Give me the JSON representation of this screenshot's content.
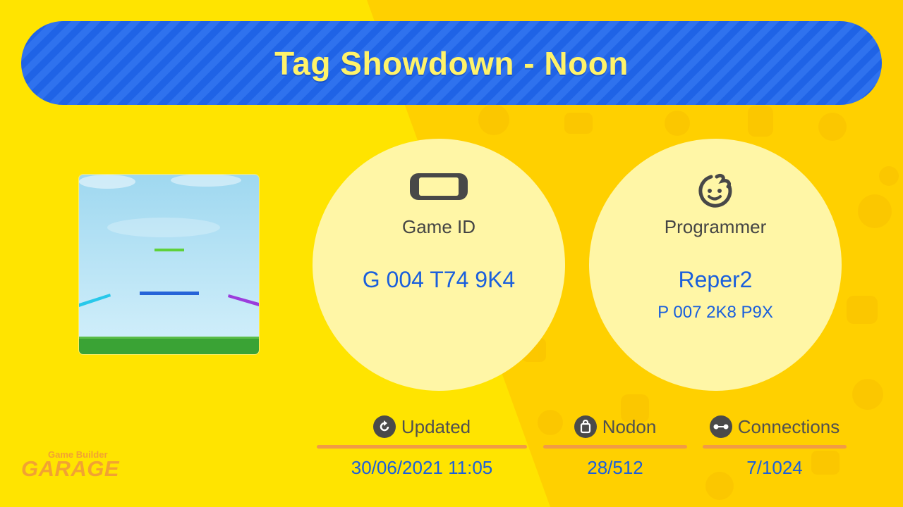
{
  "title": "Tag Showdown - Noon",
  "game_id": {
    "label": "Game ID",
    "value": "G 004 T74 9K4",
    "icon": "switch-console-icon"
  },
  "programmer": {
    "label": "Programmer",
    "name": "Reper2",
    "id": "P 007 2K8 P9X",
    "icon": "face-icon"
  },
  "stats": {
    "updated": {
      "label": "Updated",
      "value": "30/06/2021 11:05",
      "icon": "refresh-icon"
    },
    "nodon": {
      "label": "Nodon",
      "value": "28/512",
      "icon": "bag-icon"
    },
    "connections": {
      "label": "Connections",
      "value": "7/1024",
      "icon": "connection-icon"
    }
  },
  "logo": {
    "top_text": "Game Builder",
    "main_text": "GARAGE"
  },
  "colors": {
    "background_yellow": "#ffe400",
    "background_orange_yellow": "#ffd000",
    "banner_blue": "#1f63e6",
    "title_yellow": "#fff36a",
    "circle_fill": "#fff6a6",
    "value_blue": "#1a5fdc",
    "stat_line_orange": "#f29b45"
  }
}
